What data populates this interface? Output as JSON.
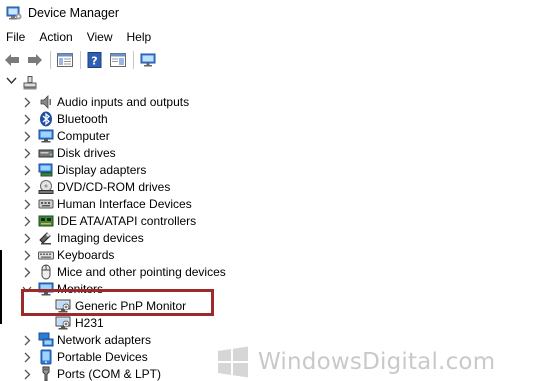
{
  "window": {
    "title": "Device Manager"
  },
  "menu": [
    "File",
    "Action",
    "View",
    "Help"
  ],
  "tree": {
    "items": [
      {
        "label": "Audio inputs and outputs",
        "icon": "speaker-icon"
      },
      {
        "label": "Bluetooth",
        "icon": "bluetooth-icon"
      },
      {
        "label": "Computer",
        "icon": "computer-icon"
      },
      {
        "label": "Disk drives",
        "icon": "disk-drive-icon"
      },
      {
        "label": "Display adapters",
        "icon": "display-adapter-icon"
      },
      {
        "label": "DVD/CD-ROM drives",
        "icon": "dvd-drive-icon"
      },
      {
        "label": "Human Interface Devices",
        "icon": "hid-icon"
      },
      {
        "label": "IDE ATA/ATAPI controllers",
        "icon": "ide-controller-icon"
      },
      {
        "label": "Imaging devices",
        "icon": "camera-icon"
      },
      {
        "label": "Keyboards",
        "icon": "keyboard-icon"
      },
      {
        "label": "Mice and other pointing devices",
        "icon": "mouse-icon"
      },
      {
        "label": "Monitors",
        "icon": "monitor-icon"
      }
    ],
    "monitors_children": [
      {
        "label": "Generic PnP Monitor",
        "icon": "monitor-icon"
      },
      {
        "label": "H231",
        "icon": "monitor-icon"
      }
    ],
    "items_after": [
      {
        "label": "Network adapters",
        "icon": "network-icon"
      },
      {
        "label": "Portable Devices",
        "icon": "portable-device-icon"
      },
      {
        "label": "Ports (COM & LPT)",
        "icon": "port-icon"
      }
    ]
  },
  "colors": {
    "highlight": "#9c2a2a",
    "watermark": "#c9c9c9"
  },
  "watermark": {
    "text": "WindowsDigital.com"
  }
}
